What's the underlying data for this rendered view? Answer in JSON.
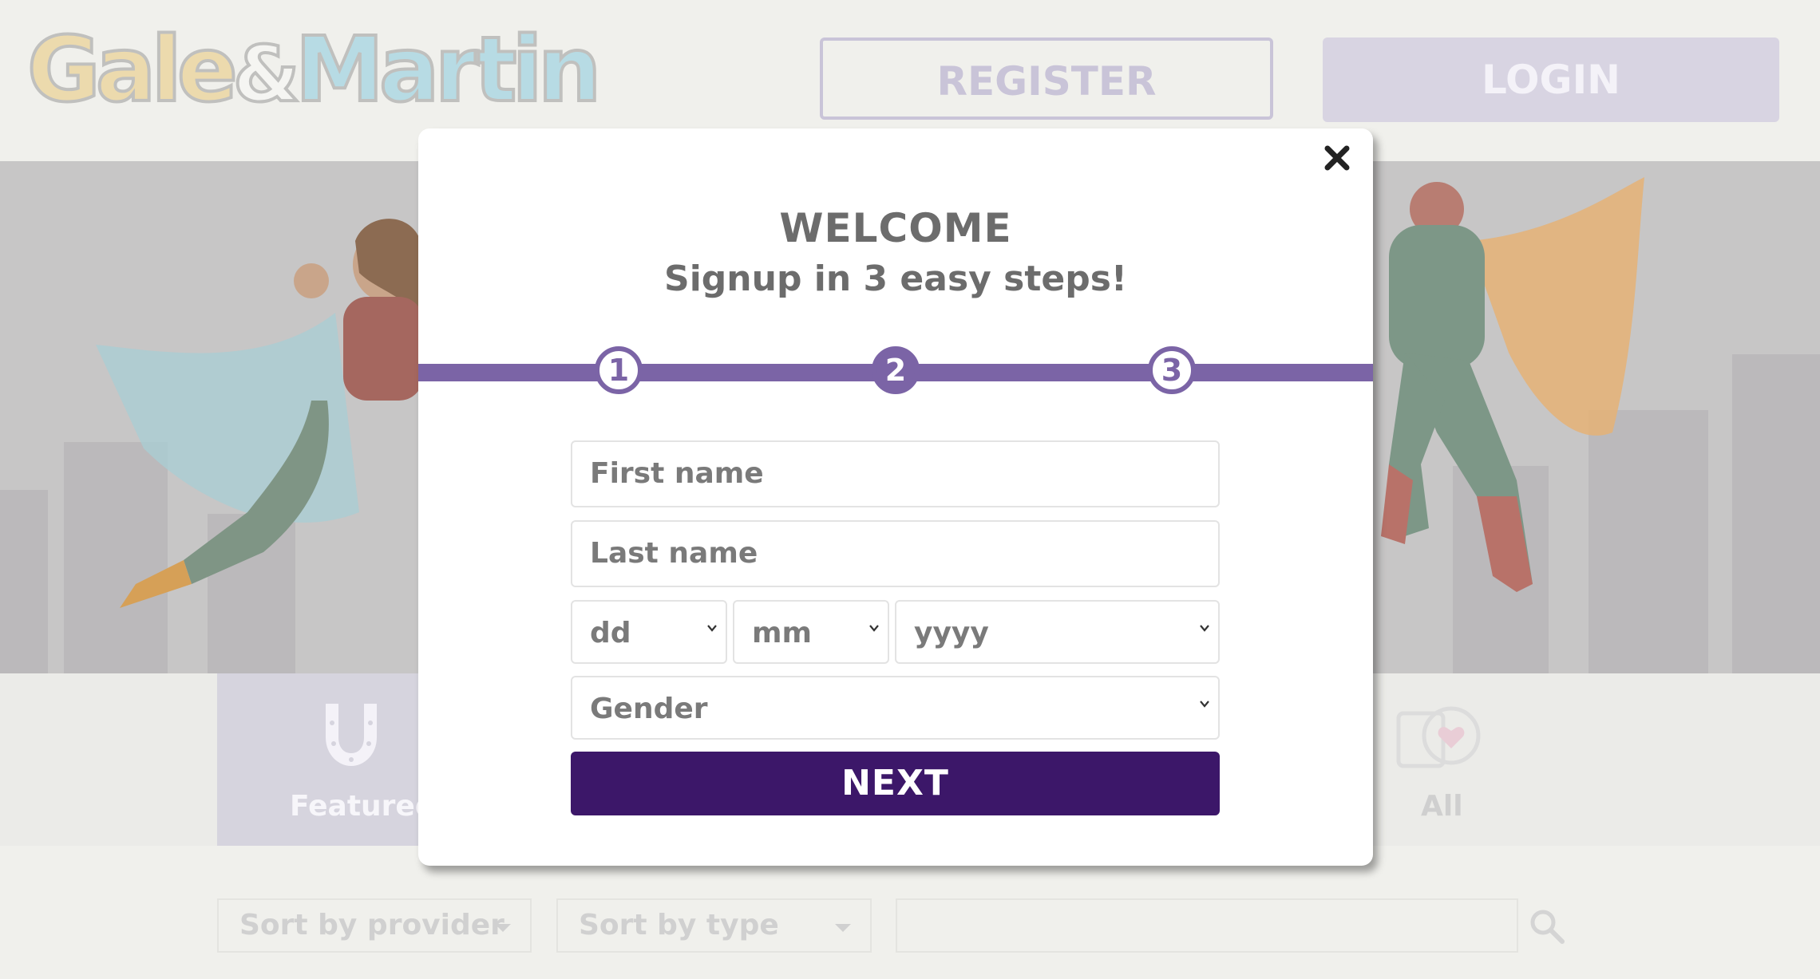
{
  "header": {
    "logo_part1": "Gale",
    "logo_amp": "&",
    "logo_part2": "Martin",
    "register_label": "REGISTER",
    "login_label": "LOGIN"
  },
  "categories": {
    "featured_label": "Featured",
    "all_label": "All"
  },
  "filters": {
    "sort_provider_label": "Sort by provider",
    "sort_type_label": "Sort by type"
  },
  "modal": {
    "title": "WELCOME",
    "subtitle": "Signup in 3 easy steps!",
    "steps": [
      "1",
      "2",
      "3"
    ],
    "active_step": 2,
    "first_name_placeholder": "First name",
    "last_name_placeholder": "Last name",
    "day_placeholder": "dd",
    "month_placeholder": "mm",
    "year_placeholder": "yyyy",
    "gender_placeholder": "Gender",
    "next_label": "NEXT"
  },
  "colors": {
    "accent": "#7b64a6",
    "button": "#3c1769",
    "text": "#6c6c6c"
  }
}
